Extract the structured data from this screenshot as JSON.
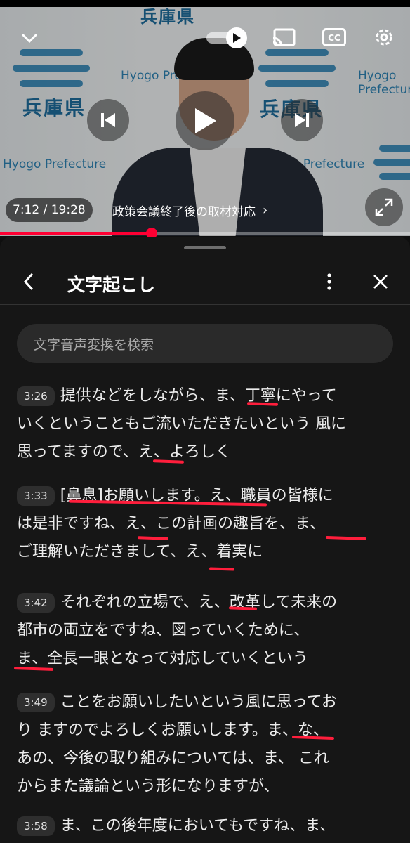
{
  "player": {
    "logo_text": "兵庫県",
    "logo_en": "Hyogo Prefecture",
    "time": "7:12 / 19:28",
    "chapter": "政策会議終了後の取材対応",
    "progress_fraction": 0.37,
    "icons": [
      "chevron-down-icon",
      "autoplay-toggle-icon",
      "cast-icon",
      "cc-icon",
      "settings-gear-icon",
      "previous-icon",
      "play-icon",
      "next-icon",
      "fullscreen-icon"
    ]
  },
  "transcript": {
    "title": "文字起こし",
    "search_placeholder": "文字音声変換を検索",
    "segments": [
      {
        "time": "3:26",
        "lines": [
          "提供などをしながら、ま、丁寧にやって",
          "いくということもご流いただきたいという 風に",
          "思ってますので、え、よろしく"
        ]
      },
      {
        "time": "3:33",
        "lines": [
          "[鼻息]お願いします。え、職員の皆様に",
          "は是非ですね、え、この計画の趣旨を、ま、",
          "ご理解いただきまして、え、着実に"
        ]
      },
      {
        "time": "3:42",
        "lines": [
          "それぞれの立場で、え、改革して未来の",
          "都市の両立をですね、図っていくために、",
          "ま、全長一眼となって対応していくという"
        ]
      },
      {
        "time": "3:49",
        "lines": [
          "ことをお願いしたいという風に思ってお",
          "り ますのでよろしくお願いします。ま、な、",
          "あの、今後の取り組みについては、ま、 これ",
          "からまた議論という形になりますが、"
        ]
      },
      {
        "time": "3:58",
        "lines": [
          "ま、この後年度においてもですね、ま、"
        ]
      }
    ]
  },
  "colors": {
    "accent": "#ff0033",
    "annotation": "#ff1e3c",
    "sheet_bg": "#161616"
  }
}
